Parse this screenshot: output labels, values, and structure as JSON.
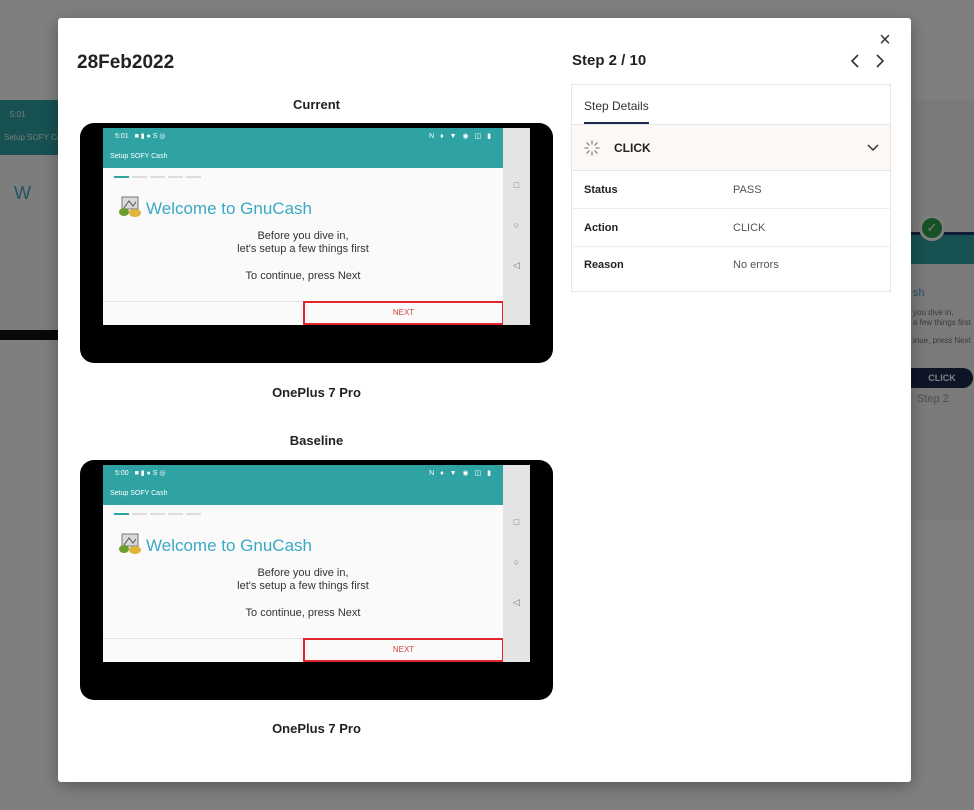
{
  "modal": {
    "date": "28Feb2022",
    "close_glyph": "×",
    "current_label": "Current",
    "baseline_label": "Baseline",
    "current_device": "OnePlus 7 Pro",
    "baseline_device": "OnePlus 7 Pro"
  },
  "current_screen": {
    "status_time": "5:01",
    "status_icons_left": "■ ▮ ● S ◎",
    "status_icons_right": "N ♦ ▼ ◉ ◫ ▮",
    "app_bar_title": "Setup SOFY Cash",
    "welcome": "Welcome to GnuCash",
    "line1": "Before you dive in,",
    "line2": "let's setup a few things first",
    "continue_text": "To continue, press Next",
    "next_label": "NEXT"
  },
  "baseline_screen": {
    "status_time": "5:00",
    "status_icons_left": "■ ▮ ● S ◎",
    "status_icons_right": "N ♦ ▼ ◉ ◫ ▮",
    "app_bar_title": "Setup SOFY Cash",
    "welcome": "Welcome to GnuCash",
    "line1": "Before you dive in,",
    "line2": "let's setup a few things first",
    "continue_text": "To continue, press Next",
    "next_label": "NEXT"
  },
  "step": {
    "title": "Step 2 / 10",
    "tab_label": "Step Details",
    "action_name": "CLICK",
    "rows": [
      {
        "key": "Status",
        "value": "PASS"
      },
      {
        "key": "Action",
        "value": "CLICK"
      },
      {
        "key": "Reason",
        "value": "No errors"
      }
    ]
  },
  "background": {
    "left_time": "5:01",
    "left_app_title": "Setup SOFY Cash",
    "left_welcome": "W",
    "right_title": "sh",
    "right_line1": "you dive in,",
    "right_line2": "a few things first",
    "right_line3": "inue, press Next",
    "right_pill": "CLICK",
    "right_step": "Step 2"
  },
  "colors": {
    "teal": "#2fa3a3",
    "navy": "#1d2b4f",
    "next_border": "#e0262b",
    "welcome_text": "#3ba9c4"
  }
}
